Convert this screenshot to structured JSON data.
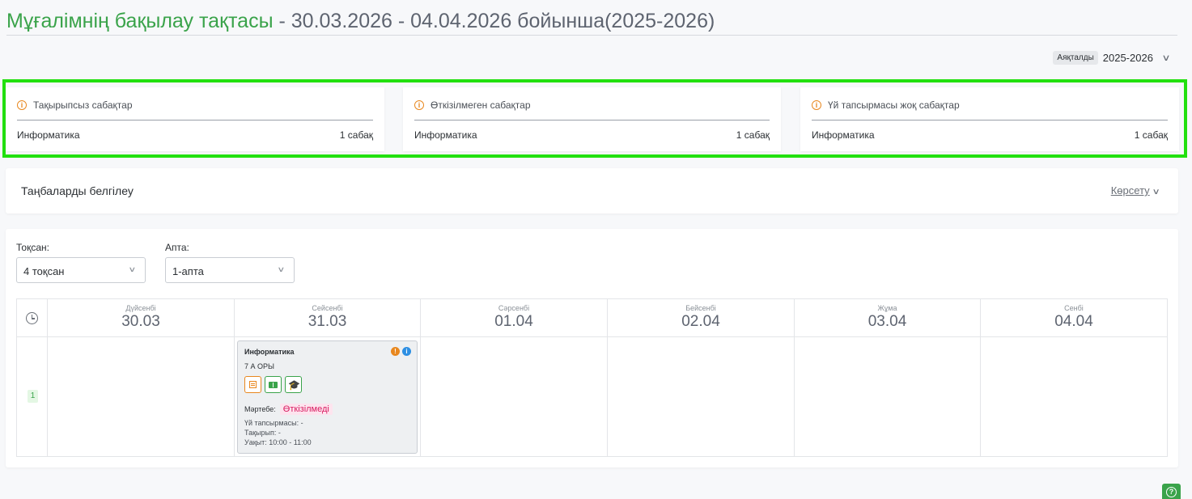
{
  "header": {
    "title_main": "Мұғалімнің бақылау тақтасы",
    "title_range": " - 30.03.2026 - 04.04.2026 бойынша(2025-2026)"
  },
  "year_filter": {
    "badge": "Аяқталды",
    "value": "2025-2026",
    "chevron": "∨"
  },
  "alerts": [
    {
      "icon": "info-circle-icon",
      "title": "Тақырыпсыз сабақтар",
      "subject": "Информатика",
      "count": "1 сабақ"
    },
    {
      "icon": "info-circle-icon",
      "title": "Өткізілмеген сабақтар",
      "subject": "Информатика",
      "count": "1 сабақ"
    },
    {
      "icon": "info-circle-icon",
      "title": "Үй тапсырмасы жоқ сабақтар",
      "subject": "Информатика",
      "count": "1 сабақ"
    }
  ],
  "marks_panel": {
    "title": "Таңбаларды белгілеу",
    "toggle": "Көрсету",
    "chevron": "∨"
  },
  "filters": {
    "quarter": {
      "label": "Тоқсан:",
      "value": "4 тоқсан",
      "chevron": "∨"
    },
    "week": {
      "label": "Апта:",
      "value": "1-апта",
      "chevron": "∨"
    }
  },
  "timetable": {
    "days": [
      {
        "name": "Дүйсенбі",
        "date": "30.03"
      },
      {
        "name": "Сейсенбі",
        "date": "31.03"
      },
      {
        "name": "Сәрсенбі",
        "date": "01.04"
      },
      {
        "name": "Бейсенбі",
        "date": "02.04"
      },
      {
        "name": "Жұма",
        "date": "03.04"
      },
      {
        "name": "Сенбі",
        "date": "04.04"
      }
    ],
    "lesson_number": "1",
    "lesson": {
      "subject": "Информатика",
      "warn_icon": "!",
      "info_icon": "i",
      "class": "7 А ОРЫ",
      "cap_icon": "🎓",
      "status_label": "Мәртебе:",
      "status_value": "Өткізілмеді",
      "homework": "Үй тапсырмасы: -",
      "topic": "Тақырып: -",
      "time": "Уақыт: 10:00 - 11:00"
    }
  },
  "help": {
    "icon": "?"
  },
  "colors": {
    "accent_green": "#3aa34a",
    "highlight_frame": "#22e00f",
    "warning_orange": "#e8871e",
    "status_pink": "#d81b60",
    "info_blue": "#2d8fe3"
  }
}
